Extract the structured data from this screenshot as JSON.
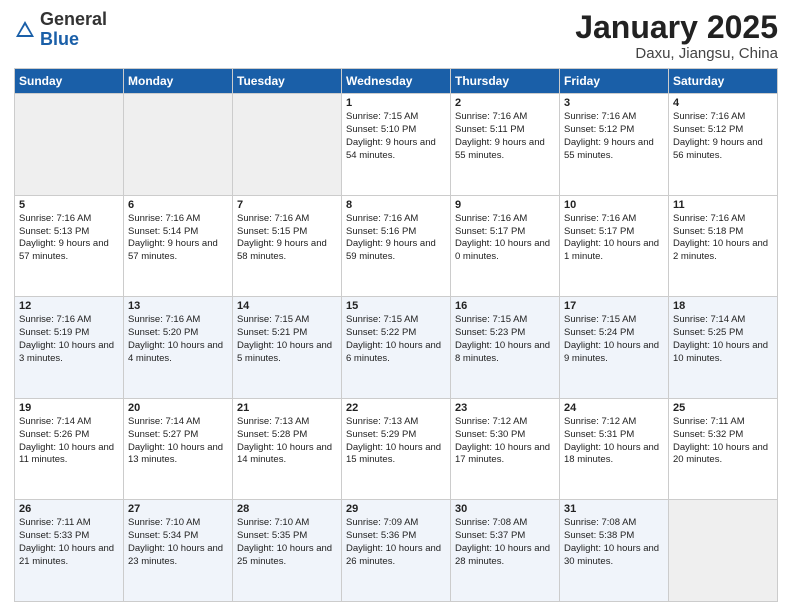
{
  "header": {
    "logo_general": "General",
    "logo_blue": "Blue",
    "title": "January 2025",
    "subtitle": "Daxu, Jiangsu, China"
  },
  "weekdays": [
    "Sunday",
    "Monday",
    "Tuesday",
    "Wednesday",
    "Thursday",
    "Friday",
    "Saturday"
  ],
  "rows": [
    [
      {
        "day": "",
        "empty": true
      },
      {
        "day": "",
        "empty": true
      },
      {
        "day": "",
        "empty": true
      },
      {
        "day": "1",
        "sunrise": "7:15 AM",
        "sunset": "5:10 PM",
        "daylight": "9 hours and 54 minutes."
      },
      {
        "day": "2",
        "sunrise": "7:16 AM",
        "sunset": "5:11 PM",
        "daylight": "9 hours and 55 minutes."
      },
      {
        "day": "3",
        "sunrise": "7:16 AM",
        "sunset": "5:12 PM",
        "daylight": "9 hours and 55 minutes."
      },
      {
        "day": "4",
        "sunrise": "7:16 AM",
        "sunset": "5:12 PM",
        "daylight": "9 hours and 56 minutes."
      }
    ],
    [
      {
        "day": "5",
        "sunrise": "7:16 AM",
        "sunset": "5:13 PM",
        "daylight": "9 hours and 57 minutes."
      },
      {
        "day": "6",
        "sunrise": "7:16 AM",
        "sunset": "5:14 PM",
        "daylight": "9 hours and 57 minutes."
      },
      {
        "day": "7",
        "sunrise": "7:16 AM",
        "sunset": "5:15 PM",
        "daylight": "9 hours and 58 minutes."
      },
      {
        "day": "8",
        "sunrise": "7:16 AM",
        "sunset": "5:16 PM",
        "daylight": "9 hours and 59 minutes."
      },
      {
        "day": "9",
        "sunrise": "7:16 AM",
        "sunset": "5:17 PM",
        "daylight": "10 hours and 0 minutes."
      },
      {
        "day": "10",
        "sunrise": "7:16 AM",
        "sunset": "5:17 PM",
        "daylight": "10 hours and 1 minute."
      },
      {
        "day": "11",
        "sunrise": "7:16 AM",
        "sunset": "5:18 PM",
        "daylight": "10 hours and 2 minutes."
      }
    ],
    [
      {
        "day": "12",
        "sunrise": "7:16 AM",
        "sunset": "5:19 PM",
        "daylight": "10 hours and 3 minutes."
      },
      {
        "day": "13",
        "sunrise": "7:16 AM",
        "sunset": "5:20 PM",
        "daylight": "10 hours and 4 minutes."
      },
      {
        "day": "14",
        "sunrise": "7:15 AM",
        "sunset": "5:21 PM",
        "daylight": "10 hours and 5 minutes."
      },
      {
        "day": "15",
        "sunrise": "7:15 AM",
        "sunset": "5:22 PM",
        "daylight": "10 hours and 6 minutes."
      },
      {
        "day": "16",
        "sunrise": "7:15 AM",
        "sunset": "5:23 PM",
        "daylight": "10 hours and 8 minutes."
      },
      {
        "day": "17",
        "sunrise": "7:15 AM",
        "sunset": "5:24 PM",
        "daylight": "10 hours and 9 minutes."
      },
      {
        "day": "18",
        "sunrise": "7:14 AM",
        "sunset": "5:25 PM",
        "daylight": "10 hours and 10 minutes."
      }
    ],
    [
      {
        "day": "19",
        "sunrise": "7:14 AM",
        "sunset": "5:26 PM",
        "daylight": "10 hours and 11 minutes."
      },
      {
        "day": "20",
        "sunrise": "7:14 AM",
        "sunset": "5:27 PM",
        "daylight": "10 hours and 13 minutes."
      },
      {
        "day": "21",
        "sunrise": "7:13 AM",
        "sunset": "5:28 PM",
        "daylight": "10 hours and 14 minutes."
      },
      {
        "day": "22",
        "sunrise": "7:13 AM",
        "sunset": "5:29 PM",
        "daylight": "10 hours and 15 minutes."
      },
      {
        "day": "23",
        "sunrise": "7:12 AM",
        "sunset": "5:30 PM",
        "daylight": "10 hours and 17 minutes."
      },
      {
        "day": "24",
        "sunrise": "7:12 AM",
        "sunset": "5:31 PM",
        "daylight": "10 hours and 18 minutes."
      },
      {
        "day": "25",
        "sunrise": "7:11 AM",
        "sunset": "5:32 PM",
        "daylight": "10 hours and 20 minutes."
      }
    ],
    [
      {
        "day": "26",
        "sunrise": "7:11 AM",
        "sunset": "5:33 PM",
        "daylight": "10 hours and 21 minutes."
      },
      {
        "day": "27",
        "sunrise": "7:10 AM",
        "sunset": "5:34 PM",
        "daylight": "10 hours and 23 minutes."
      },
      {
        "day": "28",
        "sunrise": "7:10 AM",
        "sunset": "5:35 PM",
        "daylight": "10 hours and 25 minutes."
      },
      {
        "day": "29",
        "sunrise": "7:09 AM",
        "sunset": "5:36 PM",
        "daylight": "10 hours and 26 minutes."
      },
      {
        "day": "30",
        "sunrise": "7:08 AM",
        "sunset": "5:37 PM",
        "daylight": "10 hours and 28 minutes."
      },
      {
        "day": "31",
        "sunrise": "7:08 AM",
        "sunset": "5:38 PM",
        "daylight": "10 hours and 30 minutes."
      },
      {
        "day": "",
        "empty": true
      }
    ]
  ]
}
